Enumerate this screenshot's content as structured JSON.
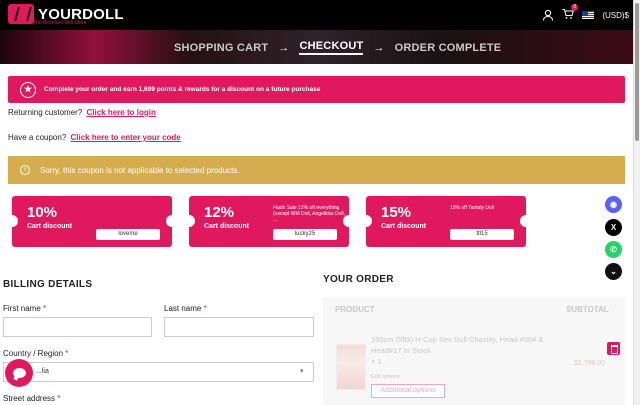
{
  "header": {
    "brand": "YOURDOLL",
    "tagline": "The Best Sex Doll Store",
    "currency": "(USD)$",
    "cart_count": "0"
  },
  "steps": [
    "SHOPPING CART",
    "CHECKOUT",
    "ORDER COMPLETE"
  ],
  "rewards_notice": "Complete your order and earn 1,699 points & rewards for a discount on a future purchase",
  "returning": {
    "text": "Returning customer?",
    "link": "Click here to login"
  },
  "coupon_prompt": {
    "text": "Have a coupon?",
    "link": "Click here to enter your code"
  },
  "warning": "Sorry, this coupon is not applicable to selected products.",
  "coupons": [
    {
      "percent": "10%",
      "label": "Cart discount",
      "desc": "",
      "code": "loveme"
    },
    {
      "percent": "12%",
      "label": "Cart discount",
      "desc": "Flash Sale 12% off everything (except WM Doll, Angelkiss Doll, ...",
      "code": "lucky25"
    },
    {
      "percent": "15%",
      "label": "Cart discount",
      "desc": "15% off Tantaly Doll",
      "code": "ttl15"
    }
  ],
  "billing": {
    "title": "BILLING DETAILS",
    "first_name": "First name",
    "last_name": "Last name",
    "country_label": "Country / Region",
    "country_value": "...lia",
    "street_label": "Street address",
    "required_mark": "*"
  },
  "order": {
    "title": "YOUR ORDER",
    "col_product": "PRODUCT",
    "col_subtotal": "SUBTOTAL",
    "item_name": "160cm (5ft3) H-Cup Sex Doll Chastity, Head #004 & Head#17 In Stock",
    "item_qty": "× 1",
    "edit_options": "Edit options",
    "additional_options": "Additional options",
    "item_price": "$1,799.00"
  },
  "colors": {
    "brand": "#e0195e",
    "warning": "#d6ad4e",
    "discord": "#5865f2",
    "whatsapp": "#25d366"
  }
}
